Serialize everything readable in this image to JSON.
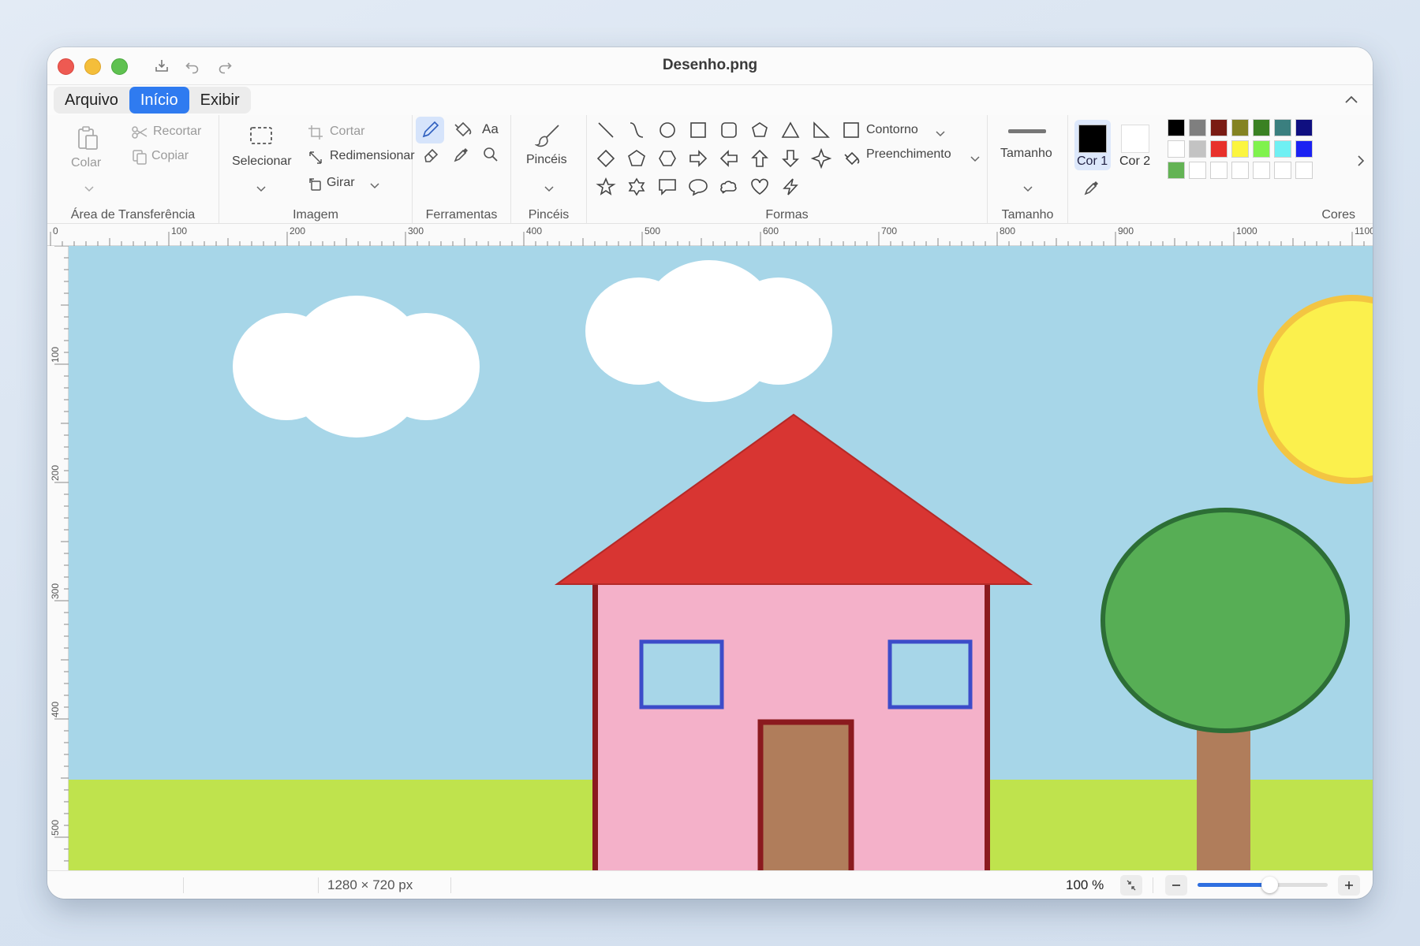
{
  "window": {
    "title": "Desenho.png"
  },
  "menu": {
    "tabs": [
      "Arquivo",
      "Início",
      "Exibir"
    ],
    "active": "Início"
  },
  "ribbon": {
    "clipboard": {
      "paste": "Colar",
      "cut": "Recortar",
      "copy": "Copiar",
      "label": "Área de Transferência"
    },
    "image": {
      "select": "Selecionar",
      "crop": "Cortar",
      "resize": "Redimensionar",
      "rotate": "Girar",
      "label": "Imagem"
    },
    "tools": {
      "text": "Aa",
      "label": "Ferramentas"
    },
    "brushes": {
      "name": "Pincéis",
      "label": "Pincéis"
    },
    "shapes": {
      "outline": "Contorno",
      "fill": "Preenchimento",
      "label": "Formas"
    },
    "size": {
      "name": "Tamanho",
      "label": "Tamanho"
    },
    "colors": {
      "color1": "Cor 1",
      "color2": "Cor 2",
      "label": "Cores",
      "color1_value": "#000000",
      "color2_value": "#ffffff",
      "palette_row1": [
        "#000000",
        "#7f7f7f",
        "#7a1b13",
        "#848322",
        "#3a8123",
        "#3a7f7f",
        "#0f0f80"
      ],
      "palette_row2": [
        "#ffffff",
        "#c3c3c3",
        "#e8302a",
        "#fbf53f",
        "#7ff24d",
        "#6ff0f3",
        "#1b22f2"
      ],
      "palette_row3": [
        "#63b354",
        "#ffffff",
        "#ffffff",
        "#ffffff",
        "#ffffff",
        "#ffffff",
        "#ffffff"
      ]
    }
  },
  "ruler": {
    "h": [
      "0",
      "100",
      "200",
      "300",
      "400",
      "500",
      "600",
      "700",
      "800",
      "900",
      "1000",
      "1100"
    ],
    "v": [
      "100",
      "200",
      "300",
      "400",
      "500"
    ]
  },
  "status": {
    "dimensions": "1280 × 720 px",
    "zoom": "100 %",
    "zoom_level": 0.55
  },
  "drawing": {
    "sky": "#a7d6e8",
    "grass": "#bfe34d",
    "roof": "#d83532",
    "wall": "#f4b1c9",
    "trim": "#8b1a1f",
    "window_frame": "#3c4cc9",
    "door": "#b07d5b",
    "trunk": "#b07d5b",
    "leaves": "#57ae55",
    "leaves_border": "#2d6e36",
    "sun": "#fbf04d",
    "sun_border": "#f3c542",
    "cloud": "#ffffff"
  }
}
